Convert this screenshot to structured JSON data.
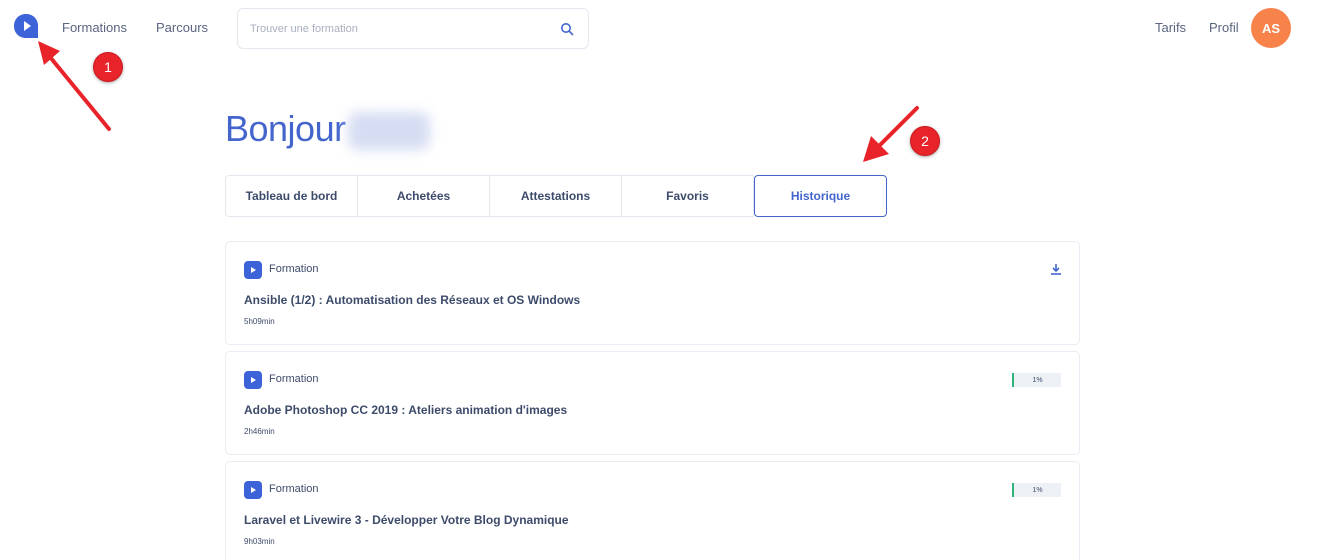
{
  "header": {
    "nav": {
      "formations": "Formations",
      "parcours": "Parcours"
    },
    "search": {
      "placeholder": "Trouver une formation",
      "value": ""
    },
    "tarifs": "Tarifs",
    "profil": "Profil",
    "avatar_initials": "AS"
  },
  "greeting": "Bonjour",
  "tabs": [
    {
      "label": "Tableau de bord"
    },
    {
      "label": "Achetées"
    },
    {
      "label": "Attestations"
    },
    {
      "label": "Favoris"
    },
    {
      "label": "Historique",
      "active": true
    }
  ],
  "courses": [
    {
      "type": "Formation",
      "title": "Ansible (1/2) : Automatisation des Réseaux et OS Windows",
      "duration": "5h09min",
      "action_icon": "download-icon"
    },
    {
      "type": "Formation",
      "title": "Adobe Photoshop CC 2019 : Ateliers animation d'images",
      "duration": "2h46min",
      "progress": "1%"
    },
    {
      "type": "Formation",
      "title": "Laravel et Livewire 3 - Développer Votre Blog Dynamique",
      "duration": "9h03min",
      "progress": "1%"
    }
  ],
  "annotations": [
    {
      "number": "1"
    },
    {
      "number": "2"
    }
  ],
  "colors": {
    "brand": "#4466cc",
    "avatar": "#f7834a",
    "annotation": "#e8232a",
    "progress": "#2fb57c"
  }
}
